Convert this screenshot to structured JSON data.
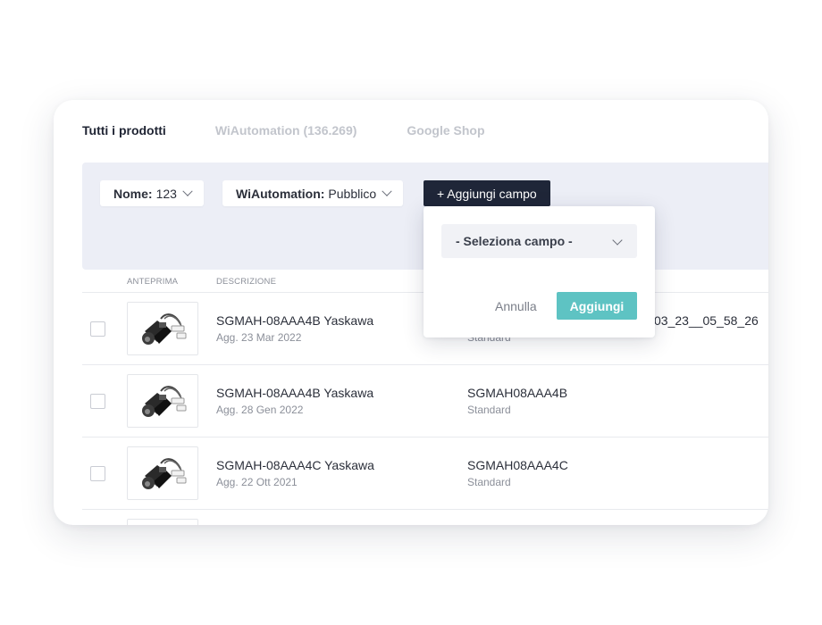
{
  "tabs": [
    {
      "label": "Tutti i prodotti",
      "active": true
    },
    {
      "label": "WiAutomation (136.269)",
      "active": false
    },
    {
      "label": "Google Shop",
      "active": false
    }
  ],
  "filters": {
    "chip1": {
      "key": "Nome:",
      "value": "123"
    },
    "chip2": {
      "key": "WiAutomation:",
      "value": "Pubblico"
    },
    "add_field_label": "+ Aggiungi campo"
  },
  "table": {
    "headers": [
      "ANTEPRIMA",
      "DESCRIZIONE"
    ],
    "rows": [
      {
        "name": "SGMAH-08AAA4B Yaskawa",
        "date": "Agg. 23 Mar 2022",
        "sku": "",
        "type": "Standard",
        "extra": "03_23__05_58_26"
      },
      {
        "name": "SGMAH-08AAA4B Yaskawa",
        "date": "Agg. 28 Gen 2022",
        "sku": "SGMAH08AAA4B",
        "type": "Standard",
        "extra": ""
      },
      {
        "name": "SGMAH-08AAA4C Yaskawa",
        "date": "Agg. 22 Ott 2021",
        "sku": "SGMAH08AAA4C",
        "type": "Standard",
        "extra": ""
      }
    ]
  },
  "popup": {
    "select_placeholder": "- Seleziona campo -",
    "cancel_label": "Annulla",
    "confirm_label": "Aggiungi"
  },
  "colors": {
    "primary_dark": "#1f2638",
    "accent_teal": "#5ec3c3",
    "filter_bg": "#eceef6"
  },
  "icons": [
    "chevron-down-icon",
    "servo-motor-image"
  ]
}
